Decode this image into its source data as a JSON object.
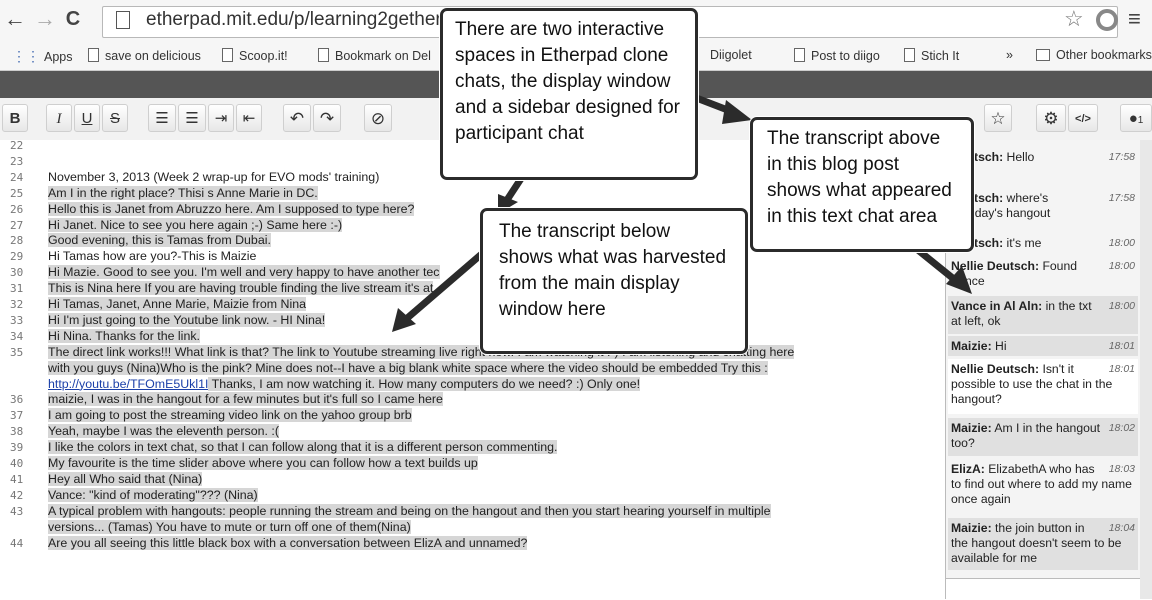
{
  "browser": {
    "nav": {
      "back": "←",
      "forward": "→",
      "reload": "C"
    },
    "url": "etherpad.mit.edu/p/learning2gether",
    "bookmarks": [
      {
        "label": "Apps"
      },
      {
        "label": "save on delicious"
      },
      {
        "label": "Scoop.it!"
      },
      {
        "label": "Bookmark on Del"
      },
      {
        "label": "Diigolet"
      },
      {
        "label": "Post to diigo"
      },
      {
        "label": "Stich It"
      },
      {
        "label": "»"
      },
      {
        "label": "Other bookmarks"
      }
    ],
    "star": "☆",
    "menu": "≡"
  },
  "toolbar": {
    "bold": "B",
    "italic": "I",
    "underline": "U",
    "strike": "S",
    "ordered_list": "☰",
    "unordered_list": "☰",
    "indent": "⇥",
    "outdent": "⇤",
    "undo": "↶",
    "redo": "↷",
    "clear": "⊘",
    "star": "☆",
    "settings": "⚙",
    "embed": "</>",
    "users": "1"
  },
  "editor": {
    "lines": [
      {
        "num": "22",
        "text": ""
      },
      {
        "num": "23",
        "text": ""
      },
      {
        "num": "24",
        "text": "November 3, 2013 (Week 2 wrap-up for EVO mods' training)"
      },
      {
        "num": "25",
        "text": "Am I in the right place? Thisi s Anne Marie in DC."
      },
      {
        "num": "26",
        "text": "Hello this is Janet from Abruzzo here.  Am I supposed to type here?"
      },
      {
        "num": "27",
        "text": "Hi Janet. Nice to see you here again ;-)  Same here :-)"
      },
      {
        "num": "28",
        "text": "Good evening, this is Tamas from Dubai."
      },
      {
        "num": "29",
        "text": "Hi Tamas how are you?-This is  Maizie"
      },
      {
        "num": "30",
        "text": "Hi Mazie. Good to see you. I'm well and very happy to have another tec"
      },
      {
        "num": "31",
        "text": "This is Nina here If you are having trouble finding the live stream it's at"
      },
      {
        "num": "32",
        "text": "Hi Tamas, Janet, Anne Marie, Maizie from Nina"
      },
      {
        "num": "33",
        "text": "Hi I'm just going to the Youtube link now.  - HI Nina!"
      },
      {
        "num": "34",
        "text": "Hi Nina. Thanks for the link."
      },
      {
        "num": "35",
        "text": "The direct link works!!!  What link is that? The link to Youtube streaming live right now.  I am watching it :-)  I am listening and chatting here"
      },
      {
        "num": "",
        "text": "with you guys (Nina)Who is the pink? Mine does not--I have a big blank white space where the video should be embedded Try this :"
      },
      {
        "num": "",
        "text": "http://youtu.be/TFOmE5Ukl1I  Thanks, I am now watching it.  How many computers do we need?  :)  Only one!"
      },
      {
        "num": "36",
        "text": " maizie, I was in the hangout for a few minutes but it's full so I came here"
      },
      {
        "num": "37",
        "text": " I am going to post the streaming video link on the yahoo group brb"
      },
      {
        "num": "38",
        "text": " Yeah, maybe I was the eleventh person.  :("
      },
      {
        "num": "39",
        "text": "I like the colors in text chat, so that I can follow along that it is a different person commenting."
      },
      {
        "num": "40",
        "text": "My favourite is the time slider above where you can follow how a text builds up"
      },
      {
        "num": "41",
        "text": "Hey all  Who said that (Nina)"
      },
      {
        "num": "42",
        "text": "Vance: \"kind of moderating\"??? (Nina)"
      },
      {
        "num": "43",
        "text": "A typical problem with hangouts: people running the stream and being on the hangout and then you start hearing yourself in multiple"
      },
      {
        "num": "",
        "text": "versions... (Tamas) You have to mute or turn off one of them(Nina)"
      },
      {
        "num": "44",
        "text": "Are you all seeing this little black box with a conversation between ElizA and unnamed?"
      }
    ]
  },
  "chat": {
    "messages": [
      {
        "author": "Deutsch:",
        "text": "Hello",
        "time": "17:58"
      },
      {
        "author": "Deutsch:",
        "text": "where's",
        "text2": "to today's hangout",
        "time": "17:58"
      },
      {
        "author": "Deutsch:",
        "text": "it's me",
        "time": "18:00"
      },
      {
        "author": "Nellie Deutsch:",
        "text": "Found Vance",
        "time": "18:00"
      },
      {
        "author": "Vance in Al Aln:",
        "text": "in the txt at left, ok",
        "time": "18:00"
      },
      {
        "author": "Maizie:",
        "text": "Hi",
        "time": "18:01"
      },
      {
        "author": "Nellie Deutsch:",
        "text": "Isn't it possible to use the chat in the hangout?",
        "time": "18:01"
      },
      {
        "author": "Maizie:",
        "text": "Am I in the hangout too?",
        "time": "18:02"
      },
      {
        "author": "ElizA:",
        "text": "ElizabethA who has to find out where to add my name once again",
        "time": "18:03"
      },
      {
        "author": "Maizie:",
        "text": "the join button in the hangout doesn't seem to be available for me",
        "time": "18:04"
      }
    ]
  },
  "callouts": {
    "top": "There are two interactive spaces in Etherpad clone chats, the display window and a sidebar designed for participant chat",
    "right": "The transcript above in this blog post shows what appeared in this text chat area",
    "middle": "The transcript below shows what was harvested from the main display window here"
  }
}
